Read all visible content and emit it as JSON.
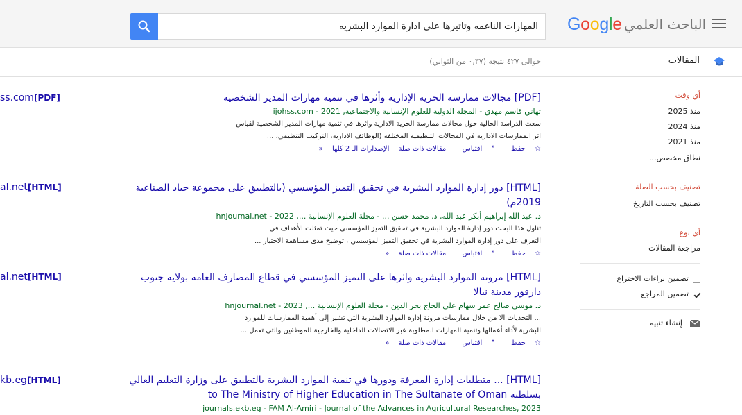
{
  "header": {
    "logo_google": "Google",
    "logo_scholar": "الباحث العلمي",
    "search_value": "المهارات الناعمه وتاثيرها على ادارة الموارد البشريه"
  },
  "subbar": {
    "section_label": "المقالات",
    "stats": "حوالى ٤٢٧ نتيجة (٠,٣٧ من الثواني)"
  },
  "sidebar": {
    "time_head": "أي وقت",
    "since_2025": "منذ 2025",
    "since_2024": "منذ 2024",
    "since_2021": "منذ 2021",
    "custom_range": "نطاق مخصص...",
    "sort_relevance": "تصنيف بحسب الصلة",
    "sort_date": "تصنيف بحسب التاريخ",
    "type_any": "أي نوع",
    "type_review": "مراجعة المقالات",
    "include_patents": "تضمين براءات الاختراع",
    "include_citations": "تضمين المراجع",
    "create_alert": "إنشاء تنبيه"
  },
  "results": [
    {
      "tag": "[PDF]",
      "title": "مجالات ممارسة الحرية الإدارية وأثرها في تنمية مهارات المدير الشخصية",
      "meta": "تهاني قاسم مهدي - المجلة الدولية للعلوم الإنسانية والاجتماعية, 2021 - ijohss.com",
      "snippet1": "سعت الدراسة الحالية حول مجالات ممارسة الحرية الادارية واثرها في تنمية مهارات المدير الشخصية لقياس",
      "snippet2": "اثر الممارسات الادارية في المجالات التنظيمية المختلفة (الوظائف الادارية، التركيب التنظيمي، ...",
      "save": "حفظ",
      "cite": "اقتباس",
      "related": "مقالات ذات صلة",
      "versions": "الإصدارات الـ 2 كلها",
      "side_tag": "[PDF]",
      "side_domain": "ss.com"
    },
    {
      "tag": "[HTML]",
      "title": "دور إدارة الموارد البشرية في تحقيق التميز المؤسسي (بالتطبيق على مجموعة جياد الصناعية 2019م)",
      "meta": "د. عبد الله إبراهيم أبكر عبد الله, د. محمد حسن ... - مجلة العلوم الإنسانية ..., 2022 - hnjournal.net",
      "snippet1": "تناول هذا البحث دور إدارة الموارد البشرية في تحقيق التميز المؤسسي حيث تمثلت الأهداف في",
      "snippet2": "التعرف على دور إدارة الموارد البشرية في تحقيق التميز المؤسسي ، توضيح مدى مساهمة الاختيار ...",
      "save": "حفظ",
      "cite": "اقتباس",
      "related": "مقالات ذات صلة",
      "versions": "",
      "side_tag": "[HTML]",
      "side_domain": "al.net"
    },
    {
      "tag": "[HTML]",
      "title": "مرونة الموارد البشرية واثرها على التميز المؤسسي في قطاع المصارف العامة بولاية جنوب دارفور مدينة نيالا",
      "meta": "د. موسي صالح عمر سهام علي الحاج بحر الدين - مجلة العلوم الإنسانية ..., 2023 - hnjournal.net",
      "snippet1": "... التحديات الا من خلال ممارسات مرونة إدارة الموارد البشرية التي تشير إلى أهمية الممارسات للموارد",
      "snippet2": "البشرية لأداء أعمالها وتنمية المهارات المطلوبة عبر الاتصالات الداخلية والخارجية للموظفين والتي تعمل ...",
      "save": "حفظ",
      "cite": "اقتباس",
      "related": "مقالات ذات صلة",
      "versions": "",
      "side_tag": "[HTML]",
      "side_domain": "al.net"
    },
    {
      "tag": "[HTML]",
      "title": "... متطلبات إدارة المعرفة ودورها في تنمية الموارد البشرية بالتطبيق على وزارة التعليم العالي بسلطنة to The Ministry of Higher Education in The Sultanate of Oman",
      "meta": "journals.ekb.eg - FAM Al-Amiri - Journal of the Advances in Agricultural Researches, 2023",
      "side_tag": "[HTML]",
      "side_domain": "kb.eg"
    }
  ]
}
